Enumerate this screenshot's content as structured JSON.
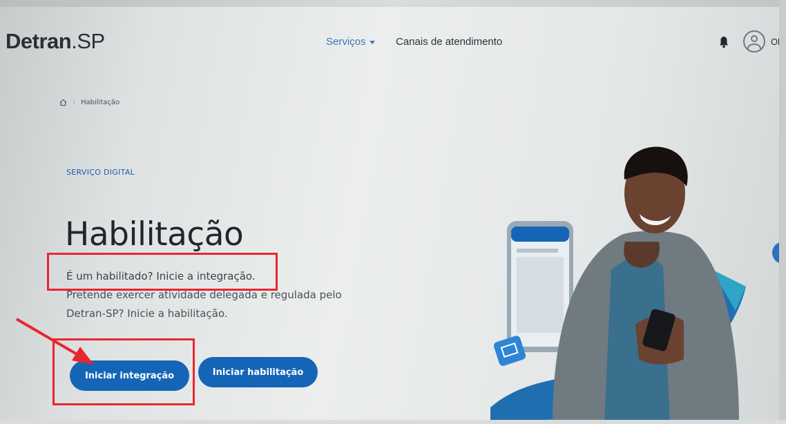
{
  "header": {
    "logo_bold": "Detran",
    "logo_light": ".SP",
    "nav": [
      {
        "label": "Serviços"
      },
      {
        "label": "Canais de atendimento"
      }
    ],
    "greeting": "Ol"
  },
  "breadcrumb": {
    "current": "Habilitação"
  },
  "hero": {
    "kicker": "SERVIÇO DIGITAL",
    "title": "Habilitação",
    "desc_line1": "É um habilitado? Inicie a integração.",
    "desc_line2": "Pretende exercer atividade delegada e regulada pelo Detran-SP? Inicie a habilitação.",
    "buttons": {
      "integracao": "Iniciar integração",
      "habilitacao": "Iniciar habilitação"
    }
  },
  "colors": {
    "primary": "#1565b7",
    "link": "#3d78b8",
    "annotation": "#e8262d"
  },
  "icons": [
    "home-icon",
    "bell-icon",
    "user-avatar-icon",
    "chevron-down-icon"
  ]
}
